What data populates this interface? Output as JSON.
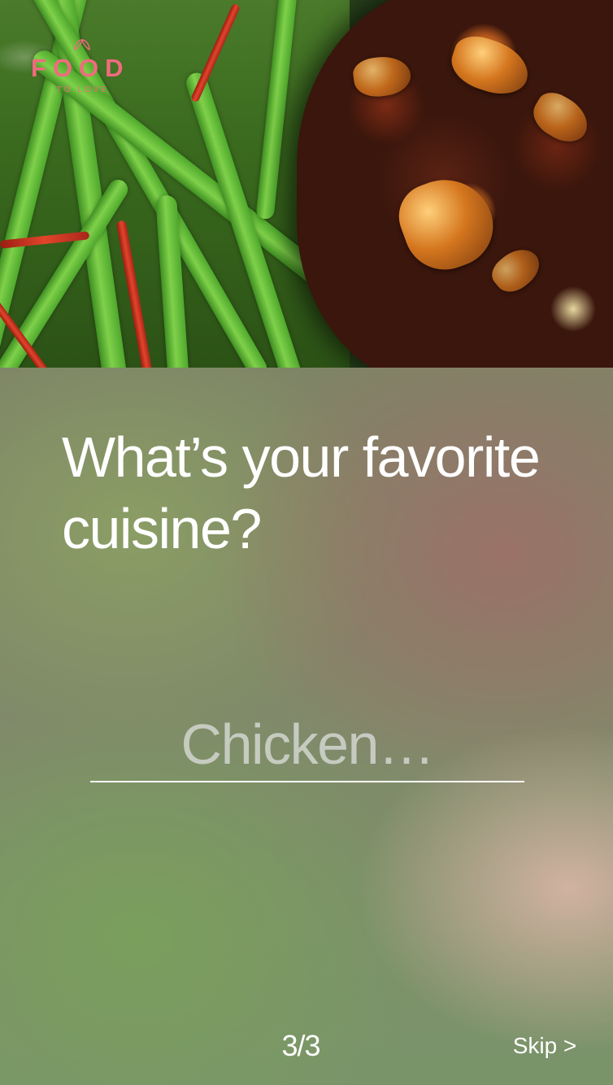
{
  "logo": {
    "word": "FOOD",
    "tagline": "TO LOVE",
    "color": "#f06b7d"
  },
  "hero": {
    "image": "glazed-meat-with-green-beans-photo"
  },
  "onboarding": {
    "question_line1": "What’s your favorite",
    "question_line2": "cuisine?",
    "answer": {
      "value": "",
      "placeholder": "Chicken…"
    },
    "page_indicator": "3/3",
    "skip_label": "Skip >"
  },
  "colors": {
    "text": "#ffffff",
    "underline": "#ffffff",
    "placeholder": "#d2d6d0"
  }
}
